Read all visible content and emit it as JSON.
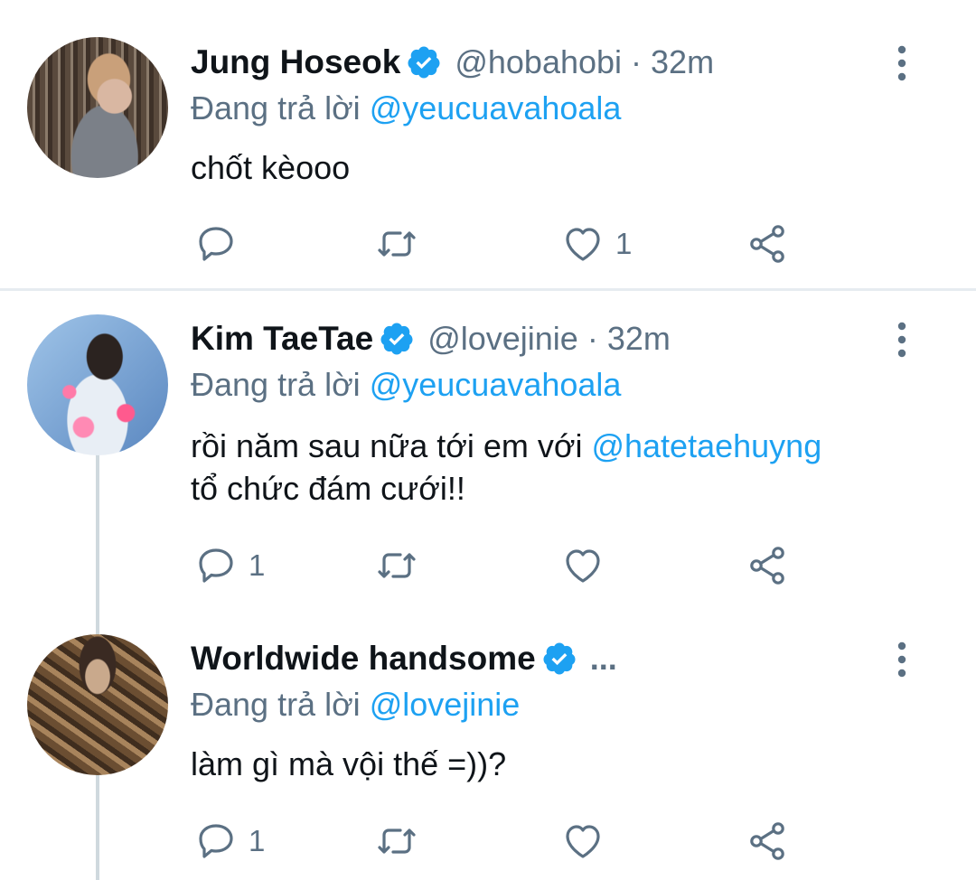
{
  "tweets": [
    {
      "name": "Jung Hoseok",
      "handle": "@hobahobi",
      "time": "32m",
      "replying_prefix": "Đang trả lời",
      "replying_to": "@yeucuavahoala",
      "text_parts": [
        "chốt kèooo"
      ],
      "mention_in_text": "",
      "text_line2": "",
      "reply_count": "",
      "retweet_count": "",
      "like_count": "1"
    },
    {
      "name": "Kim TaeTae",
      "handle": "@lovejinie",
      "time": "32m",
      "replying_prefix": "Đang trả lời",
      "replying_to": "@yeucuavahoala",
      "text_parts": [
        "rồi năm sau nữa tới em với "
      ],
      "mention_in_text": "@hatetaehuyng",
      "text_line2": "tổ chức đám cưới!!",
      "reply_count": "1",
      "retweet_count": "",
      "like_count": ""
    },
    {
      "name": "Worldwide handsome",
      "handle": "...",
      "time": "",
      "replying_prefix": "Đang trả lời",
      "replying_to": "@lovejinie",
      "text_parts": [
        "làm gì mà vội thế =))?"
      ],
      "mention_in_text": "",
      "text_line2": "",
      "reply_count": "1",
      "retweet_count": "",
      "like_count": ""
    }
  ],
  "separator": "·",
  "icons": {
    "verified": "verified-badge-icon",
    "more": "more-vertical-icon",
    "reply": "reply-icon",
    "retweet": "retweet-icon",
    "like": "heart-icon",
    "share": "share-icon"
  },
  "colors": {
    "accent": "#1da1f2",
    "secondary_text": "#5b7083",
    "divider": "#e6ecf0"
  }
}
